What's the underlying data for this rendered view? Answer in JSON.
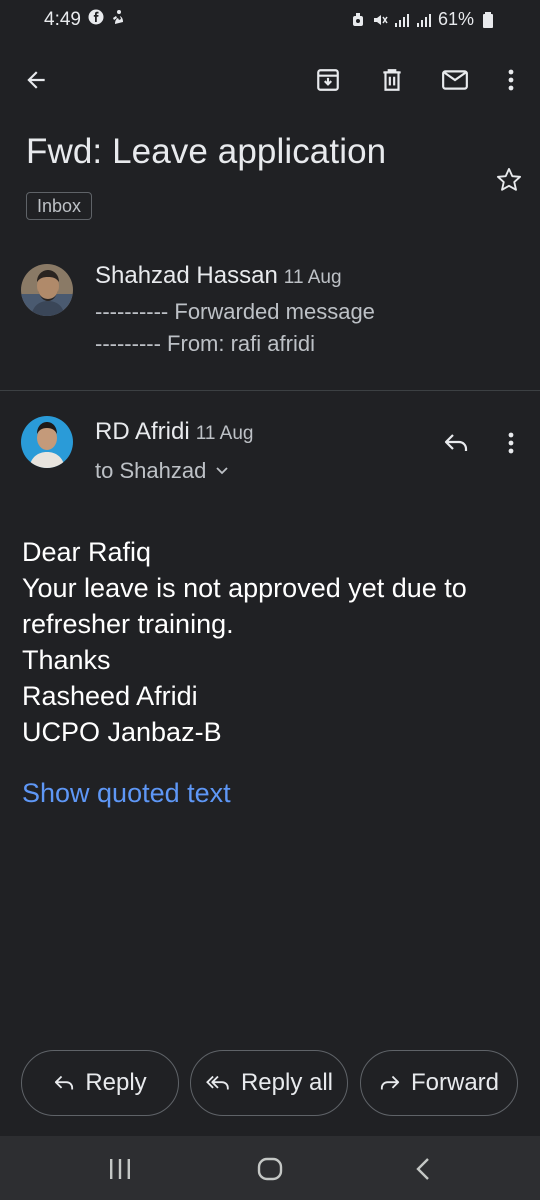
{
  "status_bar": {
    "time": "4:49",
    "battery": "61%",
    "icons": [
      "facebook-icon",
      "notification-icon",
      "alarm-icon",
      "mute-icon",
      "signal-icon",
      "signal-icon-2",
      "battery-icon"
    ]
  },
  "toolbar": {
    "icons": [
      "back-arrow-icon",
      "archive-icon",
      "delete-icon",
      "mark-unread-icon",
      "more-vert-icon"
    ]
  },
  "email": {
    "subject": "Fwd: Leave application",
    "label": "Inbox"
  },
  "messages": [
    {
      "sender": "Shahzad Hassan",
      "date": "11 Aug",
      "snippet_line1": "---------- Forwarded message",
      "snippet_line2": "--------- From: rafi afridi"
    },
    {
      "sender": "RD Afridi",
      "date": "11 Aug",
      "recipient": "to Shahzad",
      "body": [
        "Dear Rafiq",
        "Your leave is not approved yet due to",
        "refresher training.",
        "Thanks",
        "Rasheed Afridi",
        "UCPO Janbaz-B"
      ],
      "show_quoted": "Show quoted text"
    }
  ],
  "actions": {
    "reply": "Reply",
    "reply_all": "Reply all",
    "forward": "Forward"
  },
  "colors": {
    "background": "#202124",
    "link": "#5e97f6",
    "navbar": "#2d2e31"
  }
}
